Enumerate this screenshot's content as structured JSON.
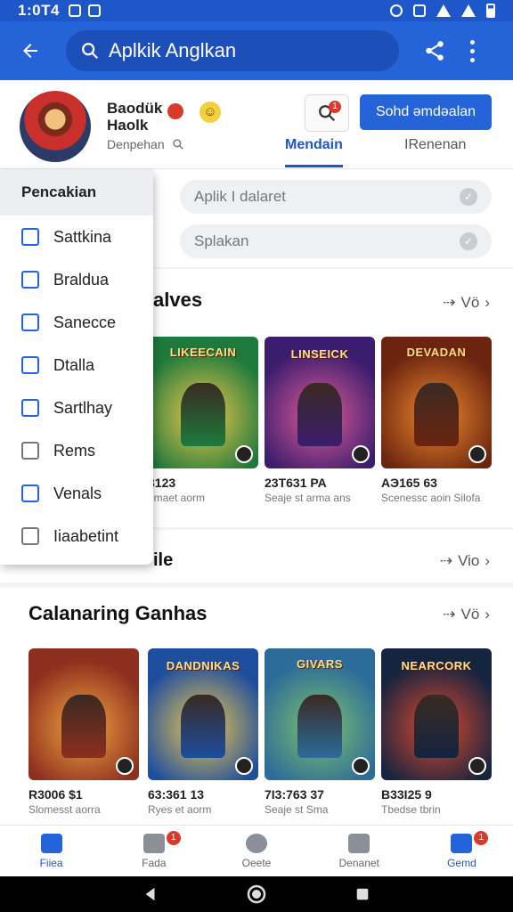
{
  "status_bar": {
    "time": "1:0T4"
  },
  "app_bar": {
    "search_text": "Aplkik Anglkan"
  },
  "profile": {
    "name_line1": "Baodük",
    "name_line2": "Haolk",
    "subtitle": "Denpehan",
    "primary_button": "Sohd əmdəalan",
    "notification_count": "1",
    "tabs": [
      {
        "label": "Mendain",
        "active": true
      },
      {
        "label": "IRenenan",
        "active": false
      }
    ]
  },
  "filters": [
    {
      "placeholder": "Aplik I dalaret"
    },
    {
      "placeholder": "Splakan"
    }
  ],
  "side_menu": {
    "header": "Pencakian",
    "items": [
      {
        "label": "Sattkina",
        "icon": "edit-icon"
      },
      {
        "label": "Braldua",
        "icon": "edit-icon"
      },
      {
        "label": "Sanecce",
        "icon": "card-icon"
      },
      {
        "label": "Dtalla",
        "icon": "tag-icon"
      },
      {
        "label": "Sartlhay",
        "icon": "sync-icon"
      },
      {
        "label": "Rems",
        "icon": "book-icon"
      },
      {
        "label": "Venals",
        "icon": "wrench-icon"
      },
      {
        "label": "Iiaabetint",
        "icon": "library-icon"
      }
    ]
  },
  "section1": {
    "title": "alves",
    "see_all": "Vö",
    "cards": [
      {
        "title": "LIKEECAIN",
        "price": "3123",
        "meta": "emaet aorm",
        "colors": [
          "#1e7a3c",
          "#f2c94c"
        ]
      },
      {
        "title": "LINSEICK",
        "price": "23T631 PA",
        "meta": "Seaje st arma ans",
        "colors": [
          "#3b1d6e",
          "#e05c97"
        ]
      },
      {
        "title": "DEVADAN",
        "price": "AЭ165 63",
        "meta": "Scenessc aoin Silofa",
        "colors": [
          "#6b2410",
          "#f08a2c"
        ]
      }
    ]
  },
  "section2": {
    "title": "ile",
    "see_all": "Vio"
  },
  "section3": {
    "title": "Calanaring Ganhas",
    "see_all": "Vö",
    "cards": [
      {
        "title": "",
        "price": "R3006 $1",
        "meta": "Slomesst aorra",
        "colors": [
          "#8c2f1e",
          "#f2a541"
        ]
      },
      {
        "title": "DANDNIKAS",
        "price": "63:361 13",
        "meta": "Ryes et aorm",
        "colors": [
          "#1d4e9e",
          "#f2c94c"
        ]
      },
      {
        "title": "GIVARS",
        "price": "7I3:763 37",
        "meta": "Seaje st Sma",
        "colors": [
          "#2c6b9a",
          "#7dc36a"
        ]
      },
      {
        "title": "NEARCORK",
        "price": "B33I25 9",
        "meta": "Tbedse tbrin",
        "colors": [
          "#15243f",
          "#e0482c"
        ]
      }
    ]
  },
  "bottom_nav": [
    {
      "label": "Fiiea",
      "icon": "home-icon",
      "active": true,
      "badge": ""
    },
    {
      "label": "Fada",
      "icon": "news-icon",
      "active": false,
      "badge": "1"
    },
    {
      "label": "Oeete",
      "icon": "search-icon",
      "active": false,
      "badge": ""
    },
    {
      "label": "Denanet",
      "icon": "inbox-icon",
      "active": false,
      "badge": ""
    },
    {
      "label": "Gemd",
      "icon": "download-icon",
      "active": true,
      "badge": "1"
    }
  ],
  "colors": {
    "primary": "#2563d8",
    "status": "#1e57c9",
    "badge": "#d93a2b"
  }
}
